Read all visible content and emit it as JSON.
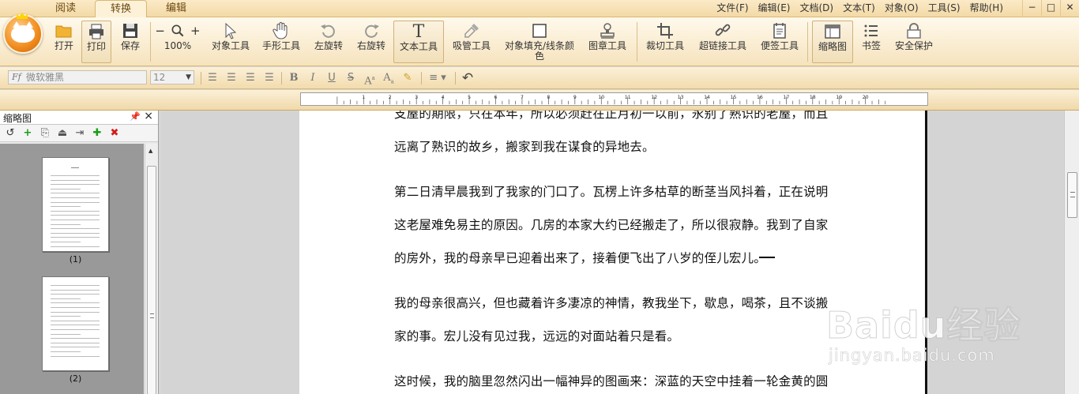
{
  "tabs": [
    "阅读",
    "转换",
    "编辑"
  ],
  "menu": [
    "文件(F)",
    "编辑(E)",
    "文档(D)",
    "文本(T)",
    "对象(O)",
    "工具(S)",
    "帮助(H)"
  ],
  "window_controls": [
    "−",
    "□",
    "✕"
  ],
  "toolbar": {
    "open": "打开",
    "print": "打印",
    "save": "保存",
    "zoom": "100%",
    "object_tool": "对象工具",
    "hand_tool": "手形工具",
    "rotate_left": "左旋转",
    "rotate_right": "右旋转",
    "text_tool": "文本工具",
    "eyedropper": "吸管工具",
    "fill_line1": "对象填充/线条颜",
    "fill_line2": "色",
    "stamp_tool": "图章工具",
    "crop_tool": "裁切工具",
    "hyperlink_tool": "超链接工具",
    "note_tool": "便签工具",
    "thumbnails": "缩略图",
    "bookmarks": "书签",
    "security": "安全保护"
  },
  "format": {
    "font_name": "微软雅黑",
    "font_size": "12"
  },
  "ruler_numbers": [
    "1",
    "2",
    "3",
    "4",
    "5",
    "6",
    "7",
    "8",
    "9",
    "10",
    "11",
    "12",
    "13",
    "14",
    "15",
    "16",
    "17",
    "18",
    "19",
    "20"
  ],
  "pane": {
    "title": "缩略图",
    "pages": [
      "(1)",
      "(2)"
    ]
  },
  "document": {
    "lines": [
      "支屋的期限，只在本年，所以必须赶在正月初一以前，永别了熟识的老屋，而且",
      "远离了熟识的故乡，搬家到我在谋食的异地去。",
      "第二日清早晨我到了我家的门口了。瓦楞上许多枯草的断茎当风抖着，正在说明",
      "这老屋难免易主的原因。几房的本家大约已经搬走了，所以很寂静。我到了自家",
      "的房外，我的母亲早已迎着出来了，接着便飞出了八岁的侄儿宏儿。",
      "我的母亲很高兴，但也藏着许多凄凉的神情，教我坐下，歇息，喝茶，且不谈搬",
      "家的事。宏儿没有见过我，远远的对面站着只是看。",
      "这时候，我的脑里忽然闪出一幅神异的图画来：深蓝的天空中挂着一轮金黄的圆"
    ]
  },
  "watermark": {
    "brand": "Baidu经验",
    "url": "jingyan.baidu.com"
  }
}
